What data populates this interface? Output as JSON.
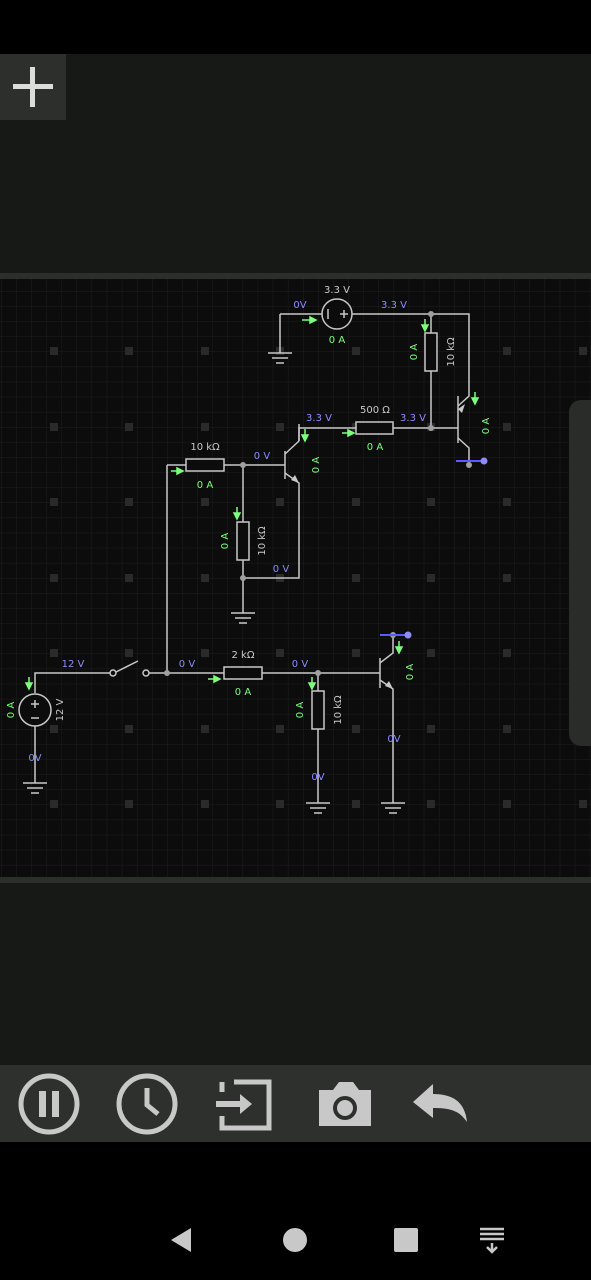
{
  "toolbar": {
    "pause_icon": "pause-icon",
    "history_icon": "clock-icon",
    "import_icon": "import-icon",
    "camera_icon": "camera-icon",
    "undo_icon": "undo-icon"
  },
  "add_button_icon": "plus-icon",
  "nav": {
    "back_icon": "triangle-back-icon",
    "home_icon": "circle-home-icon",
    "recents_icon": "square-recents-icon",
    "menu_icon": "keyboard-hide-icon"
  },
  "colors": {
    "panel": "#161916",
    "canvas": "#0c0c0c",
    "wire": "#c8c8c8",
    "voltage": "#8c8cff",
    "current": "#7cff7c",
    "toolbar": "#2d302d"
  },
  "circuit": {
    "src33": {
      "value": "3.3 V",
      "volt_left": "0V",
      "volt_right": "3.3 V",
      "current": "0 A"
    },
    "r_top": {
      "value": "10 kΩ",
      "current": "0 A"
    },
    "q_top": {
      "current": "0 A"
    },
    "r500": {
      "value": "500 Ω",
      "volt_left": "3.3 V",
      "volt_right": "3.3 V",
      "current": "0 A"
    },
    "r10k_input": {
      "value": "10 kΩ",
      "current": "0 A"
    },
    "q_mid": {
      "volt_base": "0 V",
      "current": "0 A",
      "volt_emitter": "0 V"
    },
    "r10k_mid": {
      "value": "10 kΩ",
      "current": "0 A"
    },
    "src12": {
      "value": "12 V",
      "volt_top": "12 V",
      "volt_bottom": "0V",
      "current": "0 A"
    },
    "switch": {
      "volt": "0 V"
    },
    "r2k": {
      "value": "2 kΩ",
      "volt_right": "0 V",
      "current": "0 A"
    },
    "r10k_low": {
      "value": "10 kΩ",
      "current": "0 A",
      "volt_bottom": "0V"
    },
    "q_low": {
      "current": "0 A",
      "volt_emitter": "0V"
    }
  }
}
